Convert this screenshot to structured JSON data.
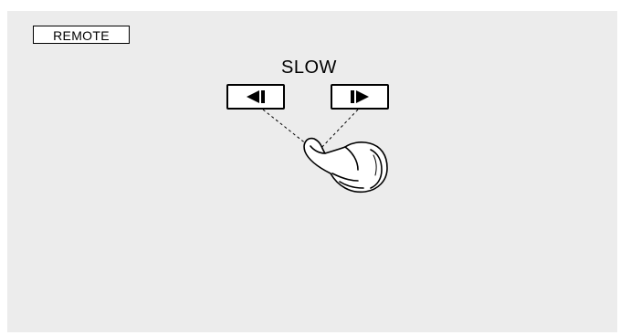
{
  "panel": {
    "background_color": "#ececec"
  },
  "remote": {
    "label": "REMOTE"
  },
  "slow_control": {
    "label": "SLOW",
    "reverse_button": {
      "icon": "slow-reverse-icon"
    },
    "forward_button": {
      "icon": "slow-forward-icon"
    }
  },
  "illustration": {
    "hand_icon": "pointing-hand-icon"
  }
}
